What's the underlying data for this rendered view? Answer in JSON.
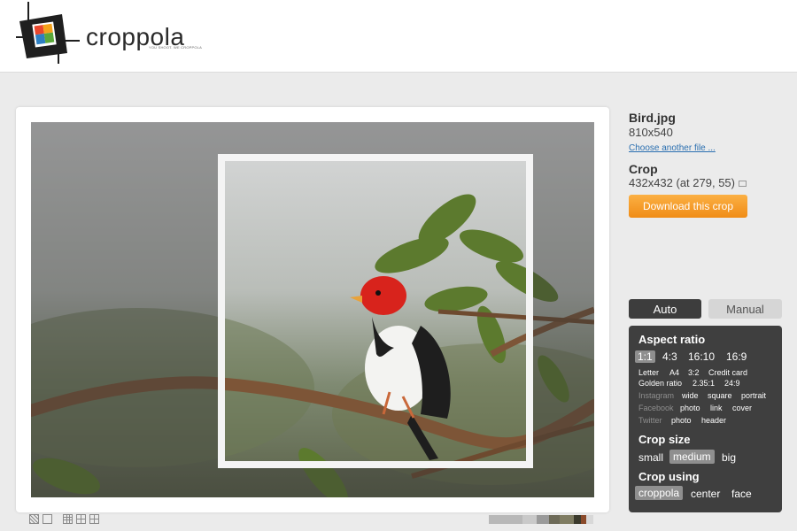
{
  "brand": {
    "name": "croppola",
    "tagline": "YOU SHOOT. WE CROPPOLA"
  },
  "file": {
    "name": "Bird.jpg",
    "dimensions": "810x540",
    "choose_link": "Choose another file ..."
  },
  "crop": {
    "title": "Crop",
    "info": "432x432 (at 279, 55)",
    "download_label": "Download this crop"
  },
  "mode": {
    "auto_label": "Auto",
    "manual_label": "Manual",
    "selected": "Auto"
  },
  "aspect": {
    "title": "Aspect ratio",
    "primary": [
      "1:1",
      "4:3",
      "16:10",
      "16:9"
    ],
    "selected": "1:1",
    "row2": [
      "Letter",
      "A4",
      "3:2",
      "Credit card"
    ],
    "row3": [
      "Golden ratio",
      "2.35:1",
      "24:9"
    ],
    "social": [
      {
        "label": "Instagram",
        "options": [
          "wide",
          "square",
          "portrait"
        ]
      },
      {
        "label": "Facebook",
        "options": [
          "photo",
          "link",
          "cover"
        ]
      },
      {
        "label": "Twitter",
        "options": [
          "photo",
          "header"
        ]
      }
    ]
  },
  "size": {
    "title": "Crop size",
    "options": [
      "small",
      "medium",
      "big"
    ],
    "selected": "medium"
  },
  "using": {
    "title": "Crop using",
    "options": [
      "croppola",
      "center",
      "face"
    ],
    "selected": "croppola"
  },
  "colors": {
    "accent": "#f39a1f",
    "panel_dark": "#3f3f3f",
    "palette": [
      "#b8b8b8",
      "#c9c9c9",
      "#9a9a9a",
      "#6d6a58",
      "#7f7c62",
      "#3b3a2c",
      "#8a4a2a",
      "#d8d8d8"
    ]
  }
}
